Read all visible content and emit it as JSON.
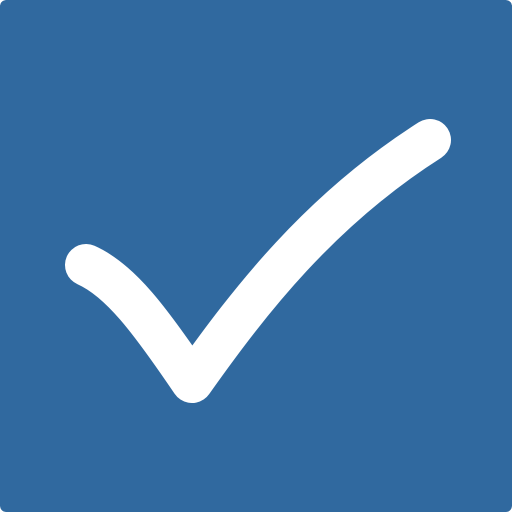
{
  "icon": {
    "name": "checkmark-icon",
    "background_color": "#30699f",
    "mark_color": "#ffffff"
  }
}
